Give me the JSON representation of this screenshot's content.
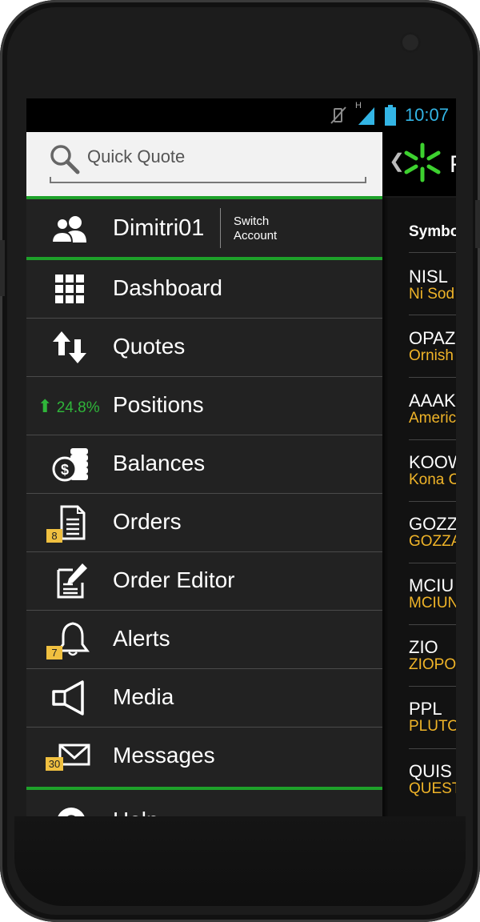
{
  "status_bar": {
    "time": "10:07",
    "network_type": "H"
  },
  "search": {
    "placeholder": "Quick Quote"
  },
  "account": {
    "username": "Dimitri01",
    "switch_line1": "Switch",
    "switch_line2": "Account"
  },
  "menu": {
    "dashboard": "Dashboard",
    "quotes": "Quotes",
    "positions": "Positions",
    "positions_change": "24.8%",
    "balances": "Balances",
    "orders": "Orders",
    "orders_badge": "8",
    "order_editor": "Order Editor",
    "alerts": "Alerts",
    "alerts_badge": "7",
    "media": "Media",
    "messages": "Messages",
    "messages_badge": "30",
    "help": "Help"
  },
  "background_panel": {
    "header_letter": "F",
    "column_header": "Symbo",
    "rows": [
      {
        "ticker": "NISL",
        "name": "Ni Sod"
      },
      {
        "ticker": "OPAZ",
        "name": "Ornish"
      },
      {
        "ticker": "AAAK",
        "name": "Americ"
      },
      {
        "ticker": "KOOW",
        "name": "Kona C"
      },
      {
        "ticker": "GOZZ",
        "name": "GOZZA"
      },
      {
        "ticker": "MCIU",
        "name": "MCIUN"
      },
      {
        "ticker": "ZIO",
        "name": "ZIOPO"
      },
      {
        "ticker": "PPL",
        "name": "PLUTO"
      },
      {
        "ticker": "QUIS",
        "name": "QUEST"
      }
    ]
  },
  "colors": {
    "accent_green": "#1ea12a",
    "badge_yellow": "#f0c040",
    "name_orange": "#f0b428",
    "time_blue": "#33b5e5"
  }
}
